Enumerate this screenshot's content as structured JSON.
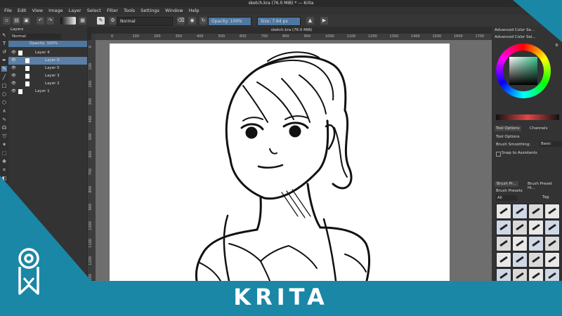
{
  "window": {
    "title": "sketch.kra (76.0 MiB) * — Krita"
  },
  "menu": [
    "File",
    "Edit",
    "View",
    "Image",
    "Layer",
    "Select",
    "Filter",
    "Tools",
    "Settings",
    "Window",
    "Help"
  ],
  "toolbar": {
    "blend_mode": "Normal",
    "opacity_label": "Opacity: 100%",
    "size_label": "Size: 7.64 px"
  },
  "layers_panel": {
    "title": "Layers",
    "blend_mode": "Normal",
    "opacity": "Opacity: 100%",
    "items": [
      {
        "name": "Layer 4",
        "selected": false
      },
      {
        "name": "Layer 6",
        "selected": true
      },
      {
        "name": "Layer 5",
        "selected": false
      },
      {
        "name": "Layer 3",
        "selected": false
      },
      {
        "name": "Layer 2",
        "selected": false
      },
      {
        "name": "Layer 1",
        "selected": false
      }
    ]
  },
  "document": {
    "tab": "sketch.kra (76.0 MiB)"
  },
  "ruler": {
    "top": [
      "0",
      "100",
      "200",
      "300",
      "400",
      "500",
      "600",
      "700",
      "800",
      "900",
      "1000",
      "1100",
      "1200",
      "1300",
      "1400",
      "1500",
      "1600",
      "1700"
    ],
    "left": [
      "0",
      "100",
      "200",
      "300",
      "400",
      "500",
      "600",
      "700",
      "800",
      "900",
      "1000",
      "1100",
      "1200",
      "1300"
    ]
  },
  "right_dock": {
    "color_title": "Advanced Color Se...",
    "color_title_2": "Advanced Color Sel...",
    "tabs": [
      "Tool Options",
      "Channels"
    ],
    "tool_options_title": "Tool Options",
    "brush_smoothing_label": "Brush Smoothing:",
    "brush_smoothing_value": "Basic",
    "snap_label": "Snap to Assistants",
    "preset_tabs": [
      "Brush Pr...",
      "Brush Preset Hi..."
    ],
    "presets_title": "Brush Presets",
    "presets_filter": "All",
    "presets_tag": "Tag"
  },
  "banner": {
    "title": "KRITA",
    "logo": "krita-logo-icon"
  },
  "colors": {
    "banner": "#1a87a6",
    "accent": "#5b7fa6",
    "ui_dark": "#333333",
    "canvas_bg": "#6e6e6e"
  }
}
